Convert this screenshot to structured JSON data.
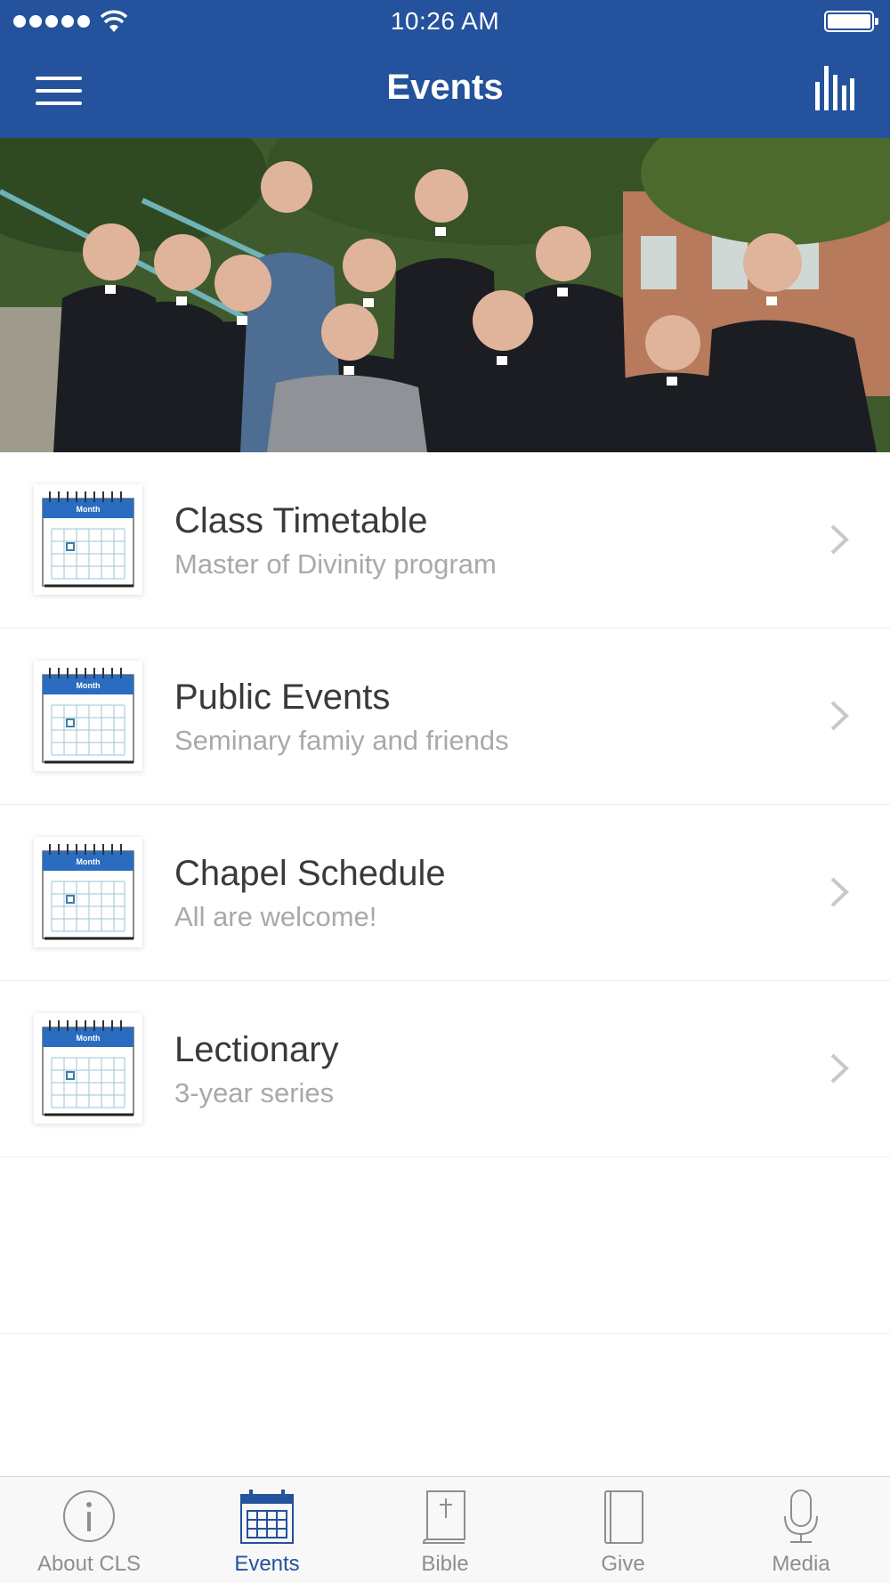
{
  "status_bar": {
    "time": "10:26 AM"
  },
  "nav": {
    "title": "Events"
  },
  "events": [
    {
      "title": "Class Timetable",
      "subtitle": "Master of Divinity program"
    },
    {
      "title": "Public Events",
      "subtitle": "Seminary famiy and friends"
    },
    {
      "title": "Chapel Schedule",
      "subtitle": "All are welcome!"
    },
    {
      "title": "Lectionary",
      "subtitle": "3-year series"
    }
  ],
  "calendar_icon_label": "Month",
  "tabs": [
    {
      "label": "About CLS",
      "icon": "info-icon",
      "active": false
    },
    {
      "label": "Events",
      "icon": "calendar-icon",
      "active": true
    },
    {
      "label": "Bible",
      "icon": "bible-icon",
      "active": false
    },
    {
      "label": "Give",
      "icon": "book-icon",
      "active": false
    },
    {
      "label": "Media",
      "icon": "microphone-icon",
      "active": false
    }
  ],
  "colors": {
    "brand": "#24529c",
    "inactive": "#8e8e8e",
    "subtitle": "#a9a9a9"
  }
}
